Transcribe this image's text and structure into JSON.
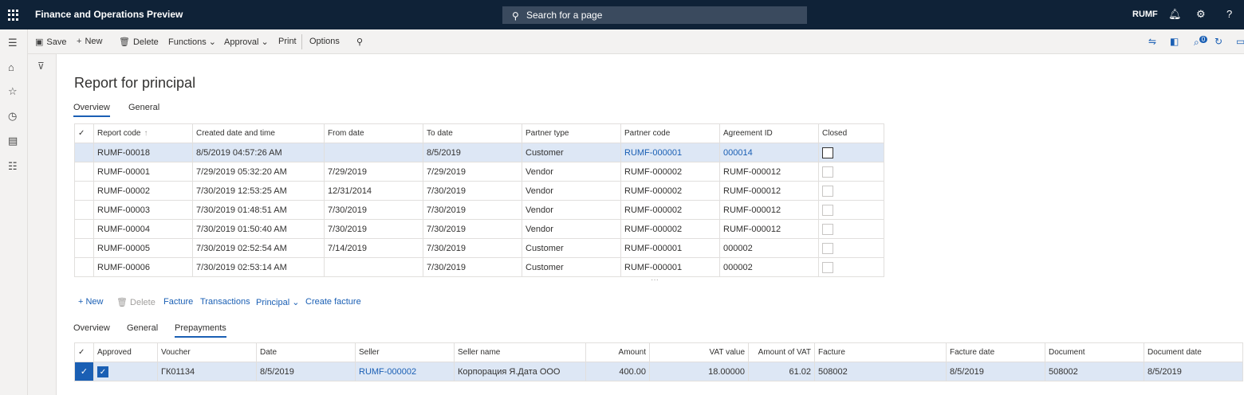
{
  "topbar": {
    "app_title": "Finance and Operations Preview",
    "search_label": "Search for a page",
    "company": "RUMF",
    "help": "?"
  },
  "actions": {
    "save": "Save",
    "new": "New",
    "delete": "Delete",
    "functions": "Functions",
    "approval": "Approval",
    "print": "Print",
    "options": "Options"
  },
  "notification_count": "0",
  "page": {
    "title": "Report for principal",
    "tabs": [
      "Overview",
      "General"
    ]
  },
  "reports": {
    "columns": [
      "Report code",
      "Created date and time",
      "From date",
      "To date",
      "Partner type",
      "Partner code",
      "Agreement ID",
      "Closed"
    ],
    "rows": [
      {
        "code": "RUMF-00018",
        "created": "8/5/2019 04:57:26 AM",
        "from": "",
        "to": "8/5/2019",
        "ptype": "Customer",
        "pcode": "RUMF-000001",
        "agreement": "000014"
      },
      {
        "code": "RUMF-00001",
        "created": "7/29/2019 05:32:20 AM",
        "from": "7/29/2019",
        "to": "7/29/2019",
        "ptype": "Vendor",
        "pcode": "RUMF-000002",
        "agreement": "RUMF-000012"
      },
      {
        "code": "RUMF-00002",
        "created": "7/30/2019 12:53:25 AM",
        "from": "12/31/2014",
        "to": "7/30/2019",
        "ptype": "Vendor",
        "pcode": "RUMF-000002",
        "agreement": "RUMF-000012"
      },
      {
        "code": "RUMF-00003",
        "created": "7/30/2019 01:48:51 AM",
        "from": "7/30/2019",
        "to": "7/30/2019",
        "ptype": "Vendor",
        "pcode": "RUMF-000002",
        "agreement": "RUMF-000012"
      },
      {
        "code": "RUMF-00004",
        "created": "7/30/2019 01:50:40 AM",
        "from": "7/30/2019",
        "to": "7/30/2019",
        "ptype": "Vendor",
        "pcode": "RUMF-000002",
        "agreement": "RUMF-000012"
      },
      {
        "code": "RUMF-00005",
        "created": "7/30/2019 02:52:54 AM",
        "from": "7/14/2019",
        "to": "7/30/2019",
        "ptype": "Customer",
        "pcode": "RUMF-000001",
        "agreement": "000002"
      },
      {
        "code": "RUMF-00006",
        "created": "7/30/2019 02:53:14 AM",
        "from": "",
        "to": "7/30/2019",
        "ptype": "Customer",
        "pcode": "RUMF-000001",
        "agreement": "000002"
      }
    ]
  },
  "lines_actions": {
    "new": "New",
    "delete": "Delete",
    "facture": "Facture",
    "transactions": "Transactions",
    "principal": "Principal",
    "create_facture": "Create facture"
  },
  "lines_tabs": [
    "Overview",
    "General",
    "Prepayments"
  ],
  "prepayments": {
    "columns": [
      "Approved",
      "Voucher",
      "Date",
      "Seller",
      "Seller name",
      "Amount",
      "VAT value",
      "Amount of VAT",
      "Facture",
      "Facture date",
      "Document",
      "Document date"
    ],
    "rows": [
      {
        "voucher": "ГК01134",
        "date": "8/5/2019",
        "seller": "RUMF-000002",
        "seller_name": "Корпорация Я.Дата ООО",
        "amount": "400.00",
        "vat_value": "18.00000",
        "amount_vat": "61.02",
        "facture": "508002",
        "facture_date": "8/5/2019",
        "document": "508002",
        "document_date": "8/5/2019"
      }
    ]
  },
  "colors": {
    "topbar": "#0f2237",
    "accent": "#1a5fb4",
    "selected_row": "#dde7f5"
  }
}
